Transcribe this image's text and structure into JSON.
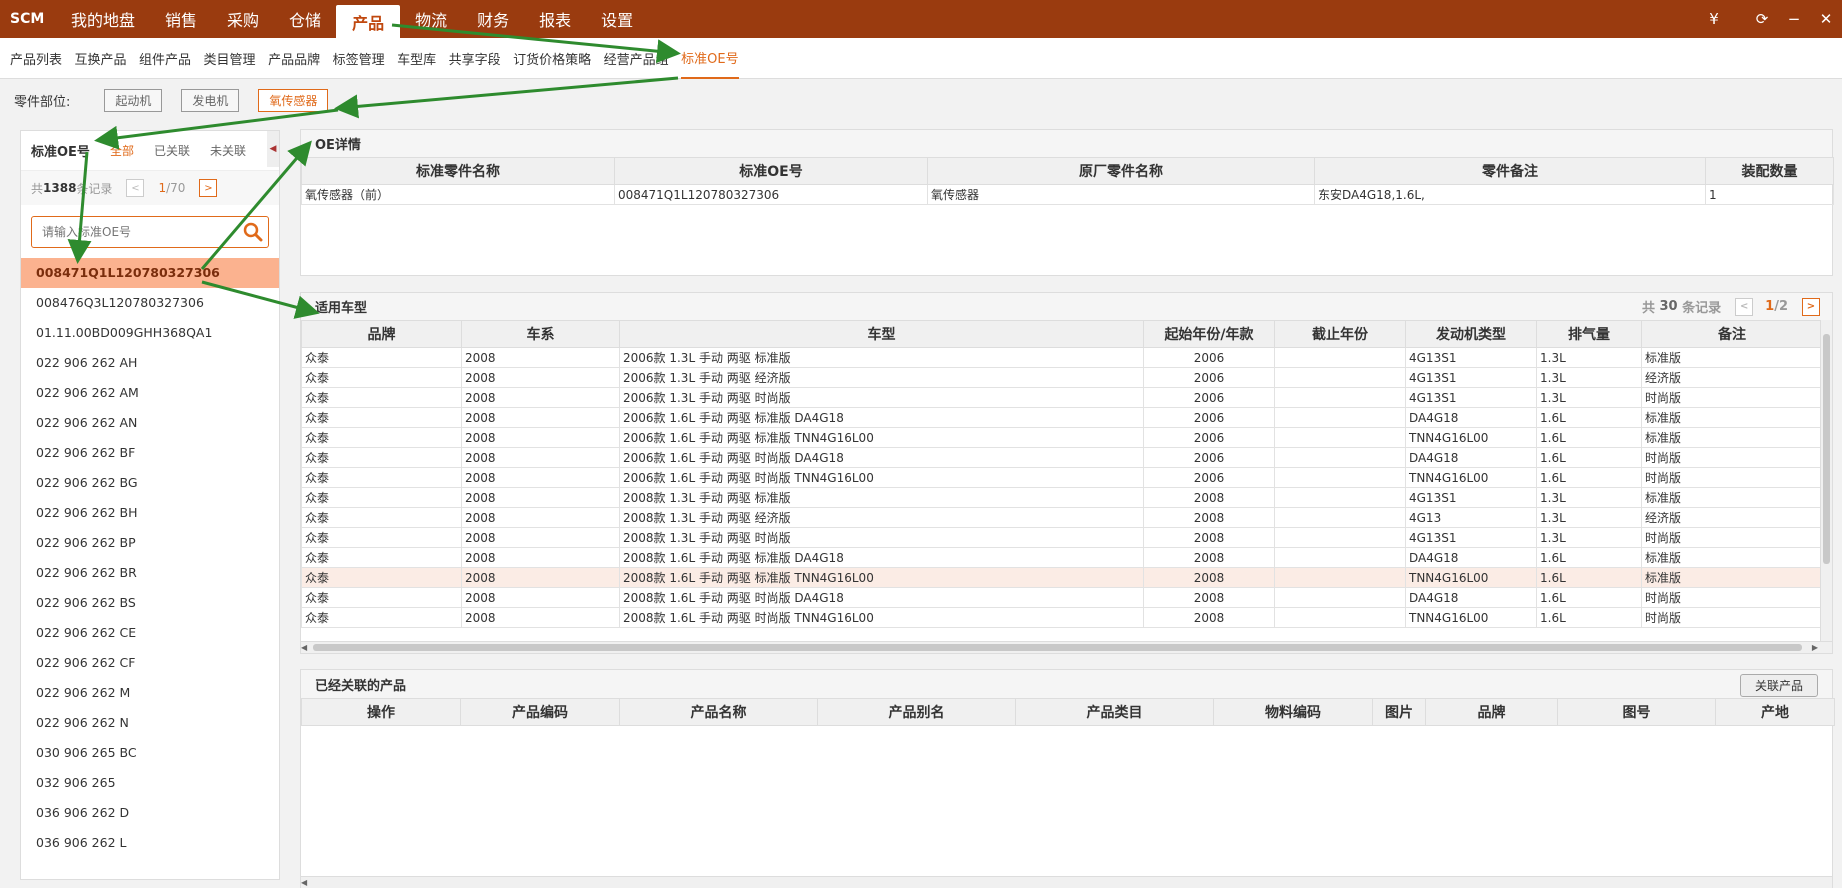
{
  "app": {
    "logo": "SCM"
  },
  "topnav": [
    "我的地盘",
    "销售",
    "采购",
    "仓储",
    "产品",
    "物流",
    "财务",
    "报表",
    "设置"
  ],
  "topnav_active": 4,
  "topright": {
    "currency": "¥",
    "refresh": "⟳",
    "minimize": "−",
    "close": "✕"
  },
  "subnav": [
    "产品列表",
    "互换产品",
    "组件产品",
    "类目管理",
    "产品品牌",
    "标签管理",
    "车型库",
    "共享字段",
    "订货价格策略",
    "经营产品组",
    "标准OE号"
  ],
  "subnav_active": 10,
  "partbar": {
    "label": "零件部位:",
    "buttons": [
      "起动机",
      "发电机",
      "氧传感器"
    ]
  },
  "left": {
    "title": "标准OE号",
    "tabs": [
      "全部",
      "已关联",
      "未关联"
    ],
    "pager": {
      "prefix": "共",
      "count": "1388",
      "suffix": "条记录",
      "current": "1",
      "total": "/70"
    },
    "search_placeholder": "请输入标准OE号",
    "items": [
      "008471Q1L120780327306",
      "008476Q3L120780327306",
      "01.11.00BD009GHH368QA1",
      "022 906 262 AH",
      "022 906 262 AM",
      "022 906 262 AN",
      "022 906 262 BF",
      "022 906 262 BG",
      "022 906 262 BH",
      "022 906 262 BP",
      "022 906 262 BR",
      "022 906 262 BS",
      "022 906 262 CE",
      "022 906 262 CF",
      "022 906 262 M",
      "022 906 262 N",
      "030 906 265 BC",
      "032 906 265",
      "036 906 262 D",
      "036 906 262 L"
    ]
  },
  "oe": {
    "title": "OE详情",
    "headers": [
      "标准零件名称",
      "标准OE号",
      "原厂零件名称",
      "零件备注",
      "装配数量"
    ],
    "row": [
      "氧传感器（前）",
      "008471Q1L120780327306",
      "氧传感器",
      "东安DA4G18,1.6L,",
      "1"
    ]
  },
  "vm": {
    "title": "适用车型",
    "pager": {
      "prefix": "共",
      "count": "30",
      "suffix": "条记录",
      "current": "1",
      "total": " /2"
    },
    "headers": [
      "品牌",
      "车系",
      "车型",
      "起始年份/年款",
      "截止年份",
      "发动机类型",
      "排气量",
      "备注"
    ],
    "rows": [
      [
        "众泰",
        "2008",
        "2006款 1.3L 手动 两驱 标准版",
        "2006",
        "",
        "4G13S1",
        "1.3L",
        "标准版"
      ],
      [
        "众泰",
        "2008",
        "2006款 1.3L 手动 两驱 经济版",
        "2006",
        "",
        "4G13S1",
        "1.3L",
        "经济版"
      ],
      [
        "众泰",
        "2008",
        "2006款 1.3L 手动 两驱 时尚版",
        "2006",
        "",
        "4G13S1",
        "1.3L",
        "时尚版"
      ],
      [
        "众泰",
        "2008",
        "2006款 1.6L 手动 两驱 标准版 DA4G18",
        "2006",
        "",
        "DA4G18",
        "1.6L",
        "标准版"
      ],
      [
        "众泰",
        "2008",
        "2006款 1.6L 手动 两驱 标准版 TNN4G16L00",
        "2006",
        "",
        "TNN4G16L00",
        "1.6L",
        "标准版"
      ],
      [
        "众泰",
        "2008",
        "2006款 1.6L 手动 两驱 时尚版 DA4G18",
        "2006",
        "",
        "DA4G18",
        "1.6L",
        "时尚版"
      ],
      [
        "众泰",
        "2008",
        "2006款 1.6L 手动 两驱 时尚版 TNN4G16L00",
        "2006",
        "",
        "TNN4G16L00",
        "1.6L",
        "时尚版"
      ],
      [
        "众泰",
        "2008",
        "2008款 1.3L 手动 两驱 标准版",
        "2008",
        "",
        "4G13S1",
        "1.3L",
        "标准版"
      ],
      [
        "众泰",
        "2008",
        "2008款 1.3L 手动 两驱 经济版",
        "2008",
        "",
        "4G13",
        "1.3L",
        "经济版"
      ],
      [
        "众泰",
        "2008",
        "2008款 1.3L 手动 两驱 时尚版",
        "2008",
        "",
        "4G13S1",
        "1.3L",
        "时尚版"
      ],
      [
        "众泰",
        "2008",
        "2008款 1.6L 手动 两驱 标准版 DA4G18",
        "2008",
        "",
        "DA4G18",
        "1.6L",
        "标准版"
      ],
      [
        "众泰",
        "2008",
        "2008款 1.6L 手动 两驱 标准版 TNN4G16L00",
        "2008",
        "",
        "TNN4G16L00",
        "1.6L",
        "标准版"
      ],
      [
        "众泰",
        "2008",
        "2008款 1.6L 手动 两驱 时尚版 DA4G18",
        "2008",
        "",
        "DA4G18",
        "1.6L",
        "时尚版"
      ],
      [
        "众泰",
        "2008",
        "2008款 1.6L 手动 两驱 时尚版 TNN4G16L00",
        "2008",
        "",
        "TNN4G16L00",
        "1.6L",
        "时尚版"
      ]
    ],
    "highlight_row": 11
  },
  "rel": {
    "title": "已经关联的产品",
    "button": "关联产品",
    "headers": [
      "操作",
      "产品编码",
      "产品名称",
      "产品别名",
      "产品类目",
      "物料编码",
      "图片",
      "品牌",
      "图号",
      "产地"
    ]
  },
  "colors": {
    "topbar": "#9a3b0f",
    "accent": "#e06a1a",
    "arrow": "#2e8b2e",
    "selected_row": "#fbb28f"
  }
}
